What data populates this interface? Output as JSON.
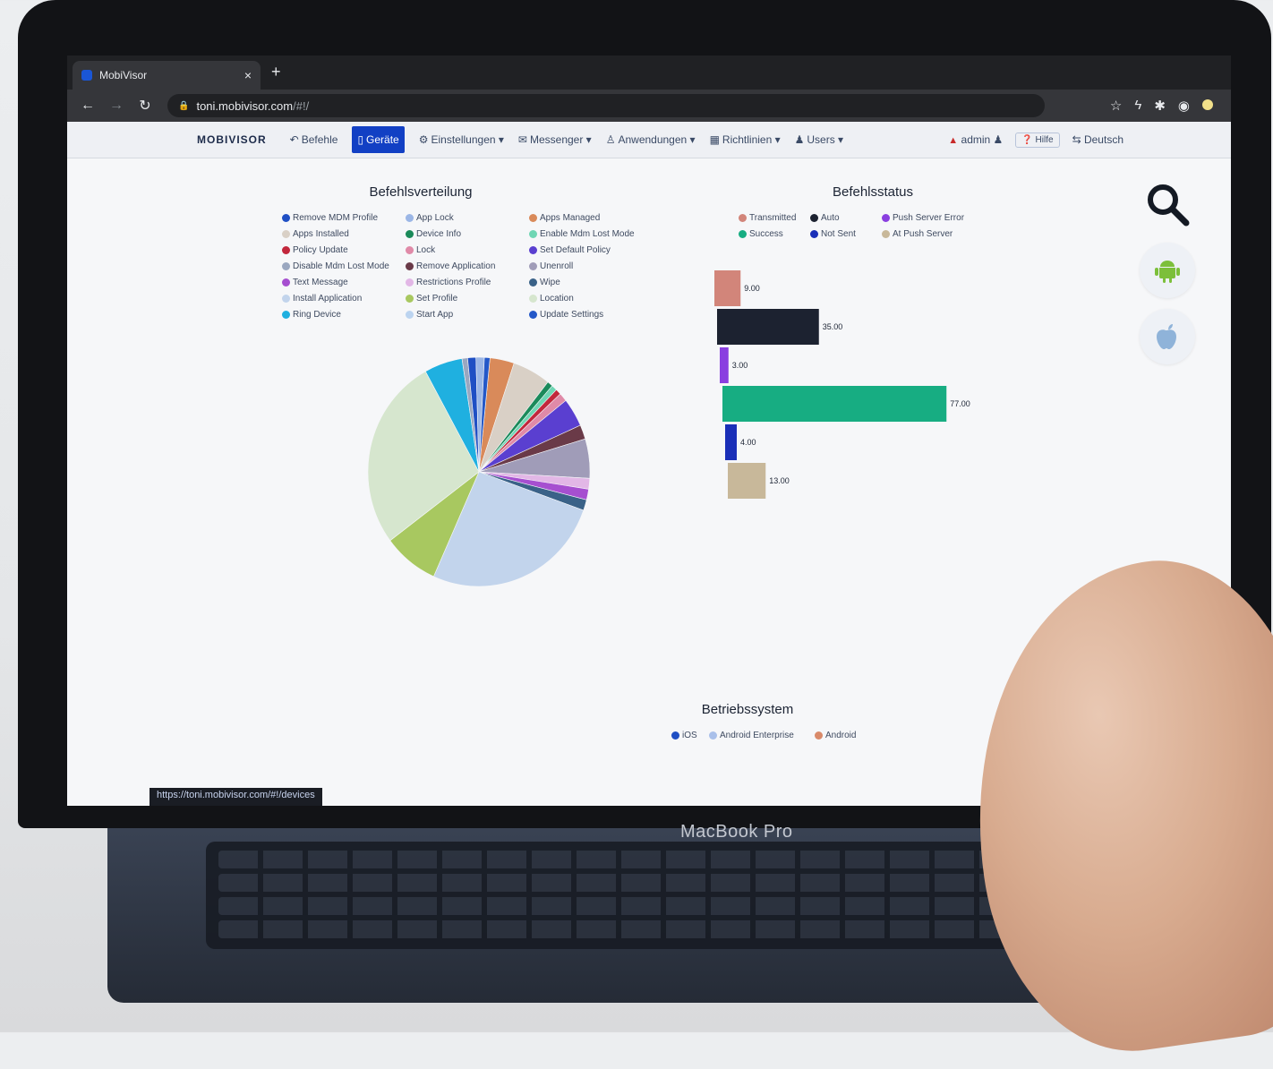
{
  "browser": {
    "tab_title": "MobiVisor",
    "tab_close": "×",
    "new_tab": "+",
    "url_host": "toni.mobivisor.com",
    "url_path": "/#!/",
    "status_url": "https://toni.mobivisor.com/#!/devices"
  },
  "nav": {
    "brand": "MOBIVISOR",
    "items": [
      {
        "label": "Befehle",
        "icon": "undo-icon"
      },
      {
        "label": "Geräte",
        "icon": "device-icon",
        "active": true
      },
      {
        "label": "Einstellungen ▾",
        "icon": "gear-icon"
      },
      {
        "label": "Messenger ▾",
        "icon": "mail-icon"
      },
      {
        "label": "Anwendungen ▾",
        "icon": "user-icon"
      },
      {
        "label": "Richtlinien ▾",
        "icon": "table-icon"
      },
      {
        "label": "Users ▾",
        "icon": "user-icon"
      }
    ],
    "admin": "admin",
    "help": "Hilfe",
    "language": "Deutsch"
  },
  "befehlsverteilung": {
    "title": "Befehlsverteilung",
    "legend": [
      {
        "label": "Remove MDM Profile",
        "color": "#1f4fc4"
      },
      {
        "label": "App Lock",
        "color": "#9bb6e6"
      },
      {
        "label": "Apps Managed",
        "color": "#d98a5a"
      },
      {
        "label": "Apps Installed",
        "color": "#d9d0c6"
      },
      {
        "label": "Device Info",
        "color": "#1b8a5a"
      },
      {
        "label": "Enable Mdm Lost Mode",
        "color": "#6fd6b4"
      },
      {
        "label": "Policy Update",
        "color": "#c2273c"
      },
      {
        "label": "Lock",
        "color": "#e08aa8"
      },
      {
        "label": "Set Default Policy",
        "color": "#5a3fd0"
      },
      {
        "label": "Disable Mdm Lost Mode",
        "color": "#9aa7c0"
      },
      {
        "label": "Remove Application",
        "color": "#6a3a48"
      },
      {
        "label": "Unenroll",
        "color": "#a09cb8"
      },
      {
        "label": "Text Message",
        "color": "#a64fd0"
      },
      {
        "label": "Restrictions Profile",
        "color": "#e2b7e6"
      },
      {
        "label": "Wipe",
        "color": "#3a6288"
      },
      {
        "label": "Install Application",
        "color": "#c2d4ec"
      },
      {
        "label": "Set Profile",
        "color": "#a8c860"
      },
      {
        "label": "Location",
        "color": "#d6e6ce"
      },
      {
        "label": "Ring Device",
        "color": "#1fb0e0"
      },
      {
        "label": "Start App",
        "color": "#bcd4f0"
      },
      {
        "label": "Update Settings",
        "color": "#2458c8"
      }
    ]
  },
  "befehlsstatus": {
    "title": "Befehlsstatus",
    "legend": [
      {
        "label": "Transmitted",
        "color": "#d2857a"
      },
      {
        "label": "Auto",
        "color": "#1c2230"
      },
      {
        "label": "Push Server Error",
        "color": "#8a3fe0"
      },
      {
        "label": "Success",
        "color": "#17ad82"
      },
      {
        "label": "Not Sent",
        "color": "#1a2fb8"
      },
      {
        "label": "At Push Server",
        "color": "#c8b89a"
      }
    ]
  },
  "betriebssystem": {
    "title": "Betriebssystem",
    "legend": [
      {
        "label": "iOS",
        "color": "#1f4fc4"
      },
      {
        "label": "Android Enterprise",
        "color": "#a9c0ea"
      },
      {
        "label": "Android",
        "color": "#d98a6a"
      }
    ]
  },
  "device_label": "MacBook Pro",
  "chart_data": [
    {
      "type": "pie",
      "title": "Befehlsverteilung",
      "slices": [
        {
          "label": "Apps Managed",
          "value": 3.5,
          "color": "#d98a5a"
        },
        {
          "label": "Apps Installed",
          "value": 5.5,
          "color": "#d9d0c6"
        },
        {
          "label": "Device Info",
          "value": 0.8,
          "color": "#1b8a5a"
        },
        {
          "label": "Enable Mdm Lost Mode",
          "value": 0.8,
          "color": "#6fd6b4"
        },
        {
          "label": "Policy Update",
          "value": 0.8,
          "color": "#c2273c"
        },
        {
          "label": "Lock",
          "value": 1.2,
          "color": "#e08aa8"
        },
        {
          "label": "Set Default Policy",
          "value": 4.0,
          "color": "#5a3fd0"
        },
        {
          "label": "Remove Application",
          "value": 2.0,
          "color": "#6a3a48"
        },
        {
          "label": "Unenroll",
          "value": 5.5,
          "color": "#a09cb8"
        },
        {
          "label": "Restrictions Profile",
          "value": 1.5,
          "color": "#e2b7e6"
        },
        {
          "label": "Text Message",
          "value": 1.5,
          "color": "#a64fd0"
        },
        {
          "label": "Wipe",
          "value": 1.5,
          "color": "#3a6288"
        },
        {
          "label": "Install Application",
          "value": 26.0,
          "color": "#c2d4ec"
        },
        {
          "label": "Set Profile",
          "value": 8.0,
          "color": "#a8c860"
        },
        {
          "label": "Location",
          "value": 27.0,
          "color": "#d6e6ce"
        },
        {
          "label": "Ring Device",
          "value": 5.5,
          "color": "#1fb0e0"
        },
        {
          "label": "Disable Mdm Lost Mode",
          "value": 0.8,
          "color": "#9aa7c0"
        },
        {
          "label": "Remove MDM Profile",
          "value": 1.2,
          "color": "#1f4fc4"
        },
        {
          "label": "App Lock",
          "value": 1.2,
          "color": "#9bb6e6"
        },
        {
          "label": "Update Settings",
          "value": 0.8,
          "color": "#2458c8"
        }
      ]
    },
    {
      "type": "bar",
      "orientation": "horizontal",
      "title": "Befehlsstatus",
      "categories": [
        "Transmitted",
        "Auto",
        "Push Server Error",
        "Success",
        "Not Sent",
        "At Push Server"
      ],
      "values": [
        9.0,
        35.0,
        3.0,
        77.0,
        4.0,
        13.0
      ],
      "value_labels": [
        "9.00",
        "35.00",
        "3.00",
        "77.00",
        "4.00",
        "13.00"
      ],
      "colors": [
        "#d2857a",
        "#1c2230",
        "#8a3fe0",
        "#17ad82",
        "#1a2fb8",
        "#c8b89a"
      ],
      "xlim": [
        0,
        80
      ]
    }
  ]
}
